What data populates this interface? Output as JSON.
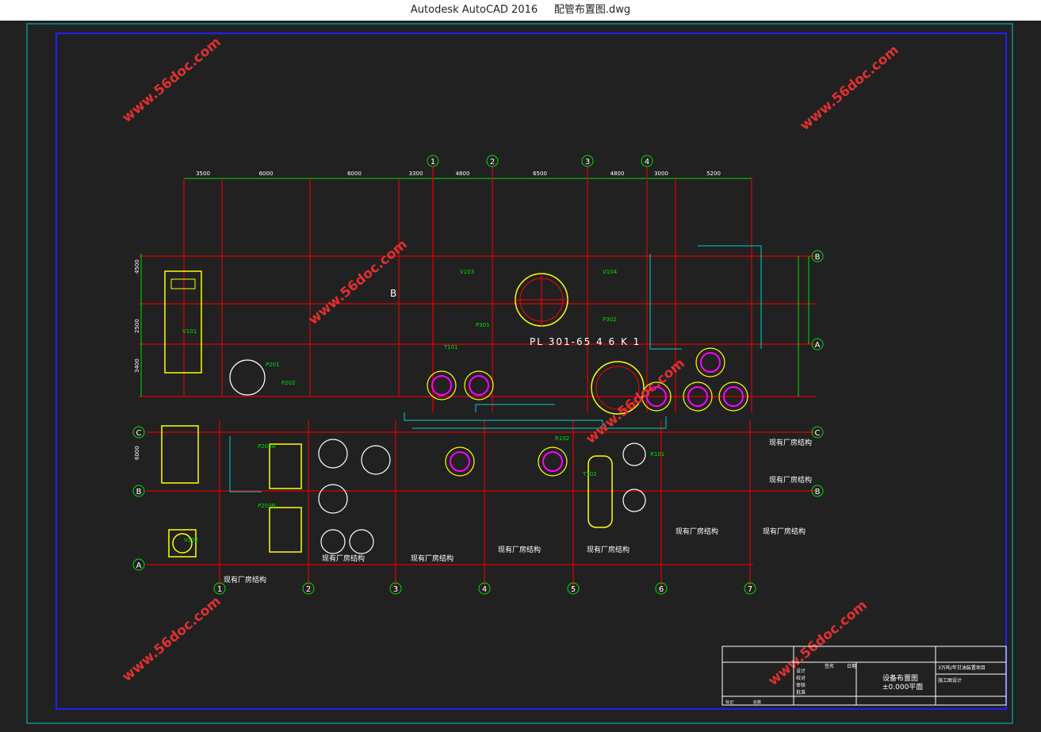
{
  "window": {
    "app": "Autodesk AutoCAD 2016",
    "file": "配管布置图.dwg"
  },
  "axes": {
    "numbers": [
      "1",
      "2",
      "3",
      "4"
    ],
    "numbers_bottom": [
      "1",
      "2",
      "3",
      "4",
      "5",
      "6",
      "7"
    ],
    "letters_right": [
      "B",
      "A"
    ],
    "letters_left": [
      "C",
      "B",
      "A"
    ],
    "letters_right_lower": [
      "C",
      "B"
    ]
  },
  "dimensions_top": [
    "3500",
    "6000",
    "6000",
    "3300",
    "4800",
    "6500",
    "4800",
    "3000",
    "5200"
  ],
  "dimensions_left": [
    "4500",
    "2500",
    "3400",
    "6000"
  ],
  "equipment_label": "PL 301-65 4 6 K 1",
  "section_mark": "B",
  "annotations": {
    "existing_note": "现有厂房结构",
    "labels": [
      "V101",
      "P201",
      "P202",
      "P203A",
      "P203B",
      "V102",
      "V103",
      "V104",
      "P301",
      "P302",
      "T101",
      "T102",
      "R101",
      "R102"
    ]
  },
  "watermark": "www.56doc.com",
  "title_block": {
    "drawing_title": "设备布置图",
    "elevation": "±0.000平面",
    "col_headers": [
      "标记",
      "处数",
      "签名",
      "日期"
    ],
    "rows": [
      "设计",
      "校对",
      "审核",
      "批准"
    ],
    "project": "3万吨/年甘油装置项目",
    "stage": "施工图设计"
  }
}
